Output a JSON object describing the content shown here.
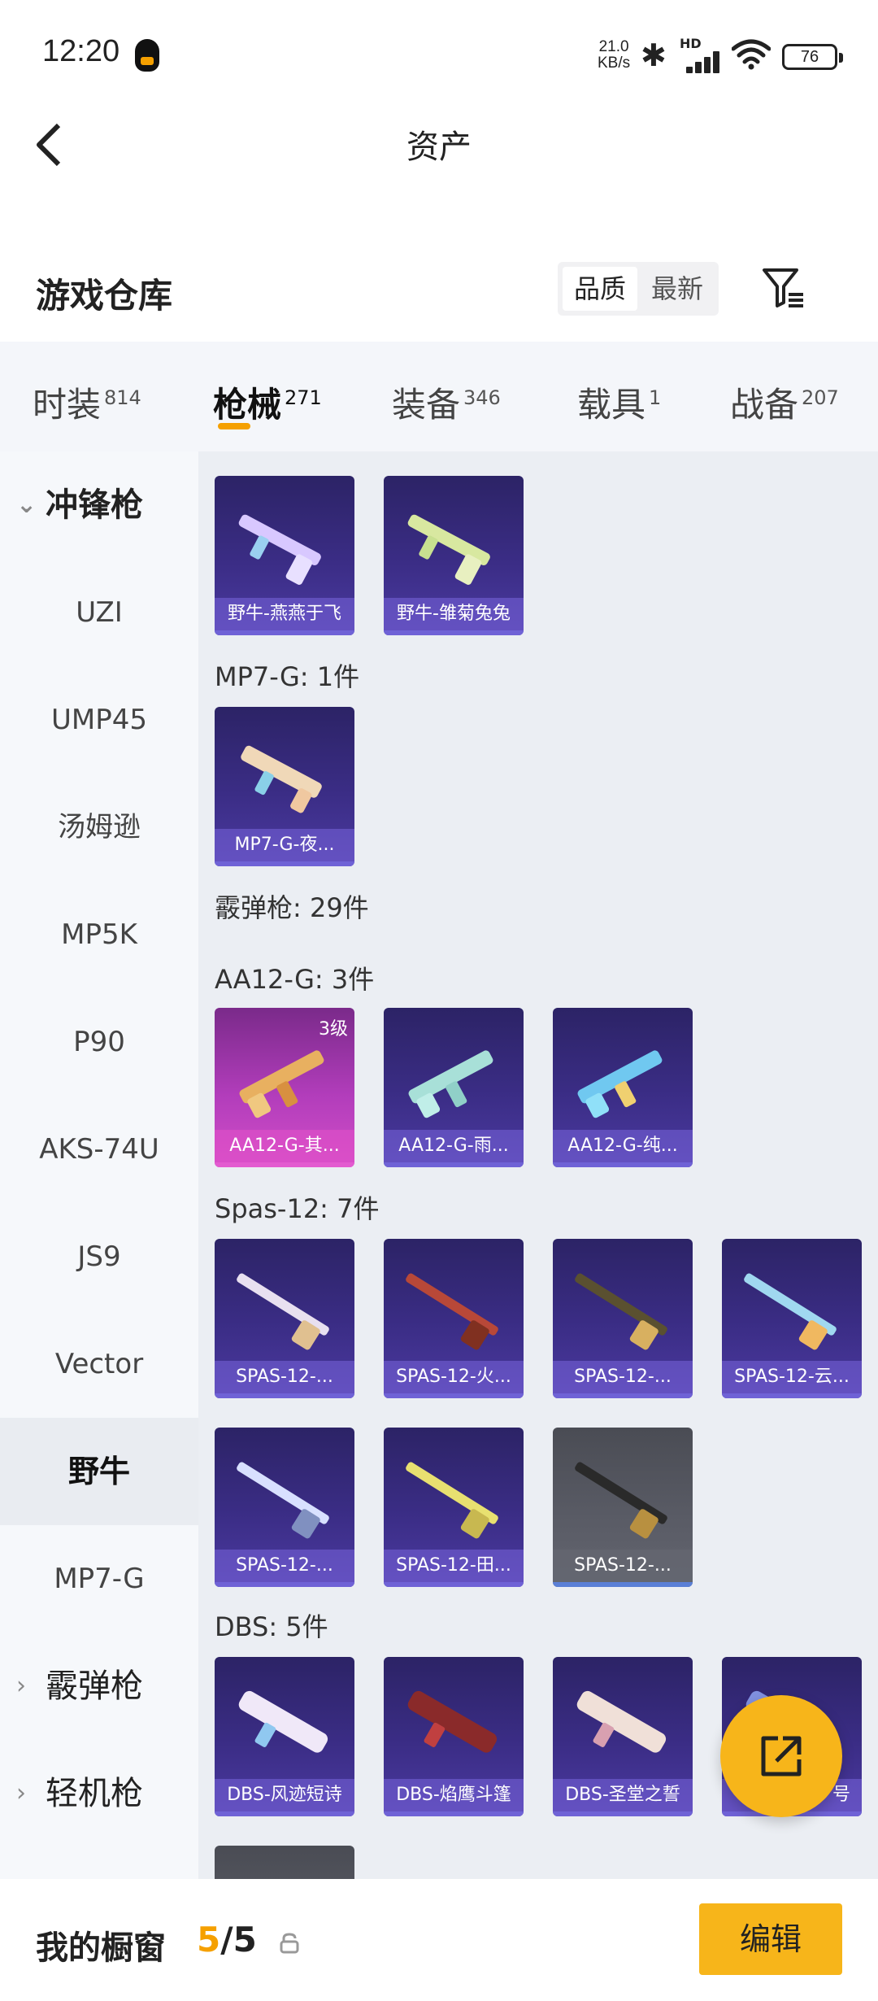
{
  "status_bar": {
    "time": "12:20",
    "net_speed_value": "21.0",
    "net_speed_unit": "KB/s",
    "hd": "HD",
    "battery": "76",
    "icons": [
      "qq-icon",
      "bluetooth-icon",
      "signal-icon",
      "wifi-icon",
      "battery-icon"
    ]
  },
  "header": {
    "title": "资产"
  },
  "warehouse": {
    "title": "游戏仓库",
    "sort_options": [
      "品质",
      "最新"
    ],
    "active_sort": "品质"
  },
  "tabs": [
    {
      "label": "时装",
      "count": "814"
    },
    {
      "label": "枪械",
      "count": "271",
      "active": true
    },
    {
      "label": "装备",
      "count": "346"
    },
    {
      "label": "载具",
      "count": "1"
    },
    {
      "label": "战备",
      "count": "207"
    }
  ],
  "sidebar": {
    "items": [
      {
        "label": "冲锋枪",
        "type": "category",
        "open": true
      },
      {
        "label": "UZI"
      },
      {
        "label": "UMP45"
      },
      {
        "label": "汤姆逊"
      },
      {
        "label": "MP5K"
      },
      {
        "label": "P90"
      },
      {
        "label": "AKS-74U"
      },
      {
        "label": "JS9"
      },
      {
        "label": "Vector"
      },
      {
        "label": "野牛",
        "selected": true
      },
      {
        "label": "MP7-G"
      },
      {
        "label": "霰弹枪",
        "type": "category"
      },
      {
        "label": "轻机枪",
        "type": "category"
      }
    ]
  },
  "content": {
    "sections": {
      "mp7": "MP7-G: 1件",
      "shotgun": "霰弹枪: 29件",
      "aa12": "AA12-G: 3件",
      "spas": "Spas-12: 7件",
      "dbs": "DBS: 5件"
    },
    "cards": {
      "bison_1": "野牛-燕燕于飞",
      "bison_2": "野牛-雏菊兔兔",
      "mp7_1": "MP7-G-夜...",
      "aa12_1": "AA12-G-其...",
      "aa12_1_level": "3级",
      "aa12_2": "AA12-G-雨...",
      "aa12_3": "AA12-G-纯...",
      "spas_1": "SPAS-12-...",
      "spas_2": "SPAS-12-火...",
      "spas_3": "SPAS-12-...",
      "spas_4": "SPAS-12-云...",
      "spas_5": "SPAS-12-...",
      "spas_6": "SPAS-12-田...",
      "spas_7": "SPAS-12-...",
      "dbs_1": "DBS-风迹短诗",
      "dbs_2": "DBS-焰鹰斗篷",
      "dbs_3": "DBS-圣堂之誓",
      "dbs_4": "号"
    },
    "colors": {
      "accent": "#f7b51a",
      "card_bg": "#3b2d86",
      "card_pink": "#b23dbb",
      "card_grey": "#5a5c66"
    }
  },
  "bottom_bar": {
    "label": "我的橱窗",
    "count_current": "5",
    "count_total": "/5",
    "edit_button": "编辑"
  }
}
